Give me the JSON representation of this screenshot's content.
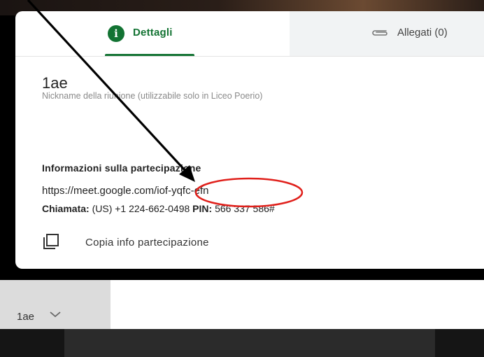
{
  "tabs": {
    "details_label": "Dettagli",
    "details_icon": "info-icon",
    "attachments_label": "Allegati (0)",
    "attachments_icon": "paperclip-icon",
    "accent_color": "#137333"
  },
  "meeting": {
    "name": "1ae",
    "nickname_note": "Nickname della riunione (utilizzabile solo in Liceo Poerio)"
  },
  "join_info": {
    "heading": "Informazioni sulla partecipazione",
    "link": "https://meet.google.com/iof-yqfc-efn",
    "dial_label": "Chiamata:",
    "dial_number": "(US) +1 224-662-0498",
    "pin_label": "PIN:",
    "pin_value": "566 337 586#"
  },
  "copy_action": {
    "label": "Copia info partecipazione",
    "icon": "copy-icon"
  },
  "bottom": {
    "meeting_select_value": "1ae",
    "select_icon": "chevron-down-icon"
  },
  "annotation": {
    "arrow_color": "#000000",
    "circle_color": "#e0201b"
  }
}
